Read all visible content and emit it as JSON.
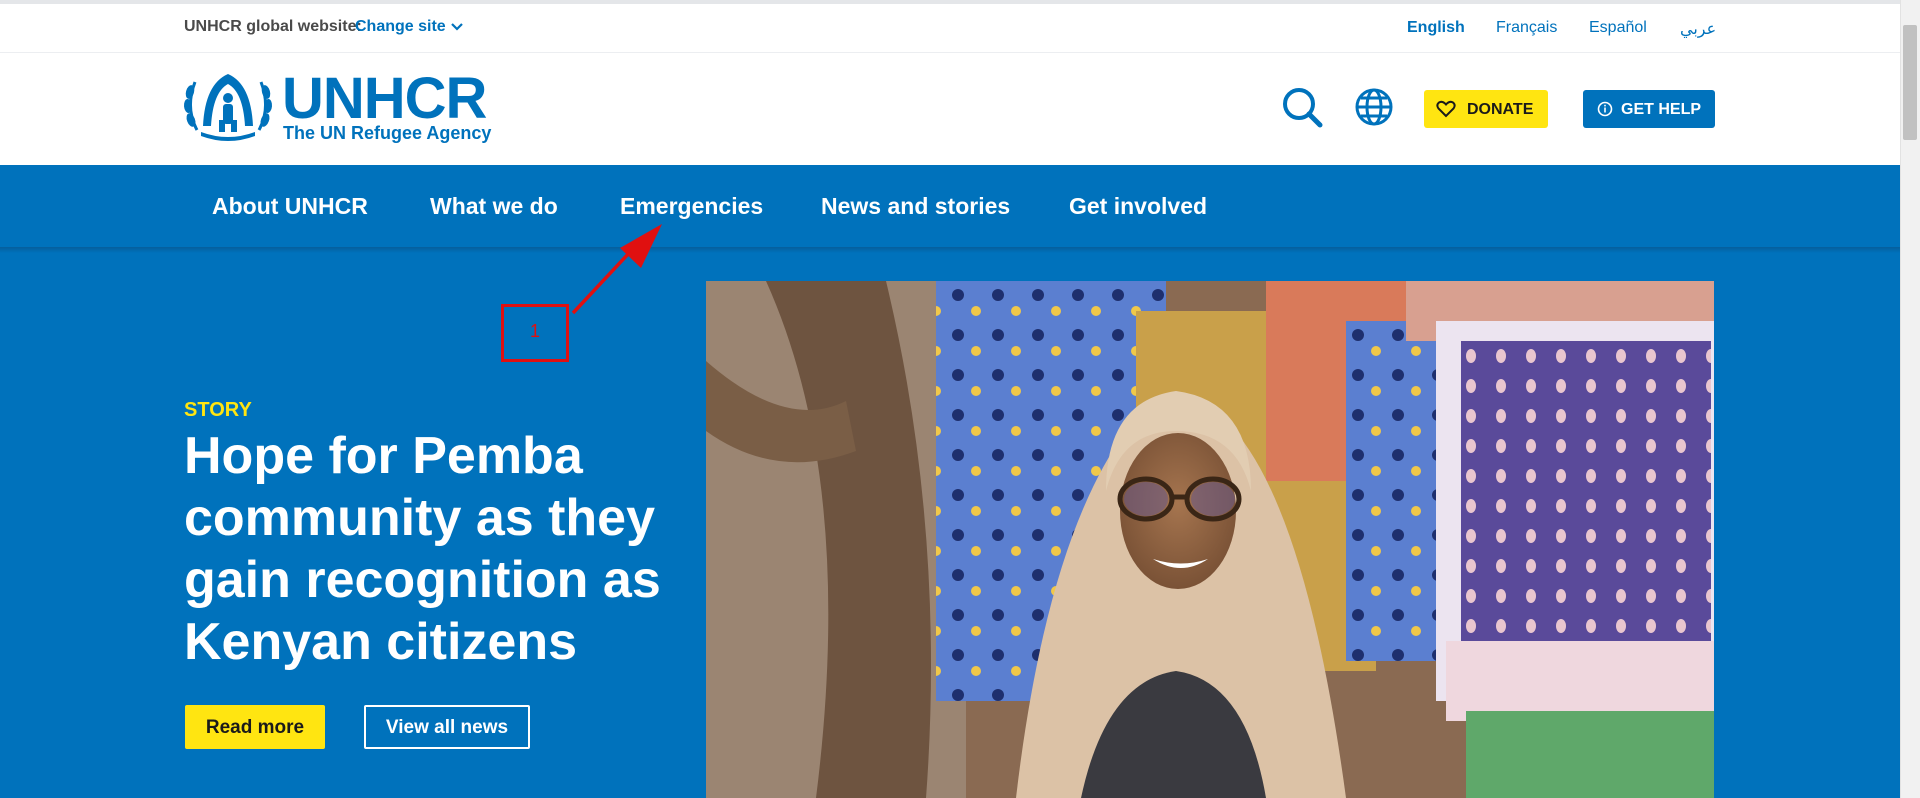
{
  "utility": {
    "global_label": "UNHCR global website:",
    "change_site": "Change site",
    "languages": [
      "English",
      "Français",
      "Español",
      "عربي"
    ]
  },
  "brand": {
    "name": "UNHCR",
    "tagline": "The UN Refugee Agency"
  },
  "header": {
    "donate": "DONATE",
    "get_help": "GET HELP",
    "icons": [
      "search-icon",
      "globe-icon",
      "heart-icon",
      "info-icon"
    ]
  },
  "nav": {
    "items": [
      "About UNHCR",
      "What we do",
      "Emergencies",
      "News and stories",
      "Get involved"
    ]
  },
  "hero": {
    "eyebrow": "STORY",
    "headline": "Hope for Pemba community as they gain recognition as Kenyan citizens",
    "read_more": "Read more",
    "view_all": "View all news"
  },
  "annotation": {
    "number": "1"
  },
  "colors": {
    "brand_blue": "#0072bc",
    "accent_yellow": "#ffe511",
    "annotation_red": "#e01010"
  }
}
